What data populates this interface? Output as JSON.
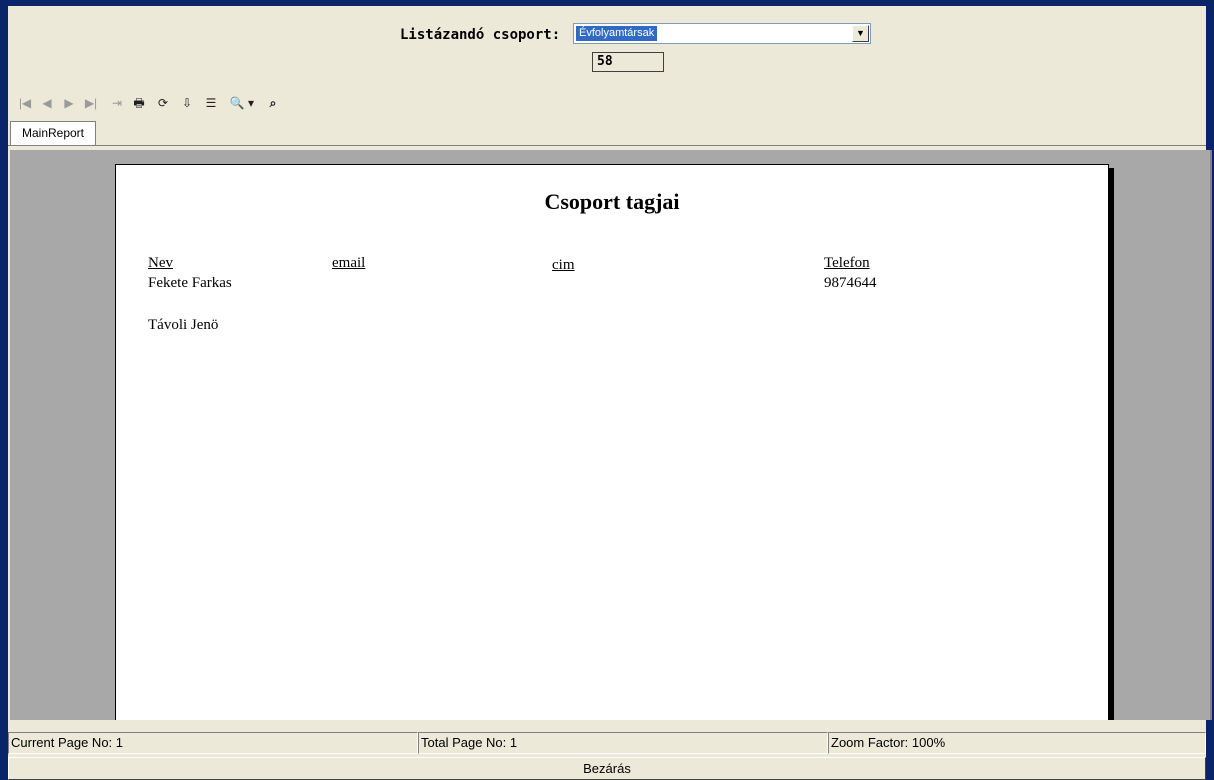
{
  "header": {
    "group_label": "Listázandó csoport:",
    "group_selected": "Évfolyamtársak",
    "count_value": "58"
  },
  "toolbar": {
    "items": [
      {
        "name": "first-page-icon",
        "glyph": "|◀"
      },
      {
        "name": "prev-page-icon",
        "glyph": "◀"
      },
      {
        "name": "next-page-icon",
        "glyph": "▶"
      },
      {
        "name": "last-page-icon",
        "glyph": "▶|"
      },
      {
        "name": "goto-page-icon",
        "glyph": "⇥"
      },
      {
        "name": "print-icon",
        "glyph": "🖶"
      },
      {
        "name": "refresh-icon",
        "glyph": "⟳"
      },
      {
        "name": "export-icon",
        "glyph": "⇩"
      },
      {
        "name": "group-tree-icon",
        "glyph": "☰"
      },
      {
        "name": "zoom-icon",
        "glyph": "🔍"
      },
      {
        "name": "zoom-dropdown-icon",
        "glyph": "▾"
      },
      {
        "name": "search-icon",
        "glyph": "⌕"
      }
    ]
  },
  "tabs": {
    "main_report": "MainReport"
  },
  "report": {
    "title": "Csoport tagjai",
    "columns": [
      "Nev",
      "email",
      "cim",
      "Telefon"
    ],
    "rows": [
      [
        "Fekete Farkas",
        "",
        "",
        "9874644"
      ],
      [
        "Távoli Jenö",
        "",
        "",
        ""
      ]
    ]
  },
  "status": {
    "current_page": "Current Page No: 1",
    "total_page": "Total Page No: 1",
    "zoom": "Zoom Factor: 100%"
  },
  "footer": {
    "close_label": "Bezárás"
  }
}
